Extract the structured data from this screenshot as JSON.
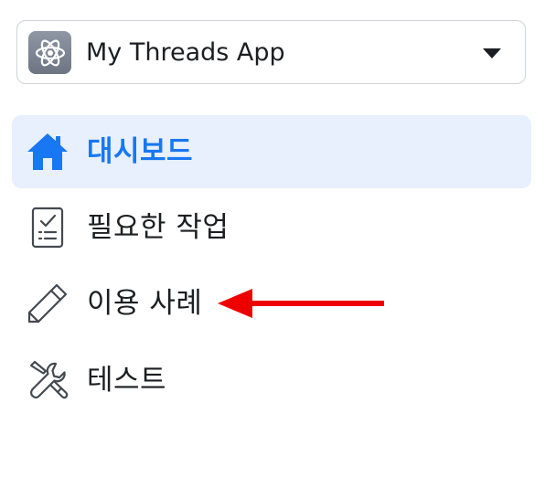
{
  "app_selector": {
    "name": "My Threads App",
    "icon": "atom-icon"
  },
  "nav": {
    "items": [
      {
        "label": "대시보드",
        "icon": "home-icon",
        "active": true
      },
      {
        "label": "필요한 작업",
        "icon": "checklist-icon",
        "active": false
      },
      {
        "label": "이용 사례",
        "icon": "pencil-icon",
        "active": false
      },
      {
        "label": "테스트",
        "icon": "tools-icon",
        "active": false
      }
    ]
  },
  "colors": {
    "accent": "#1877f2",
    "active_bg": "#e7f0fc",
    "annotation_arrow": "#ee0000"
  }
}
